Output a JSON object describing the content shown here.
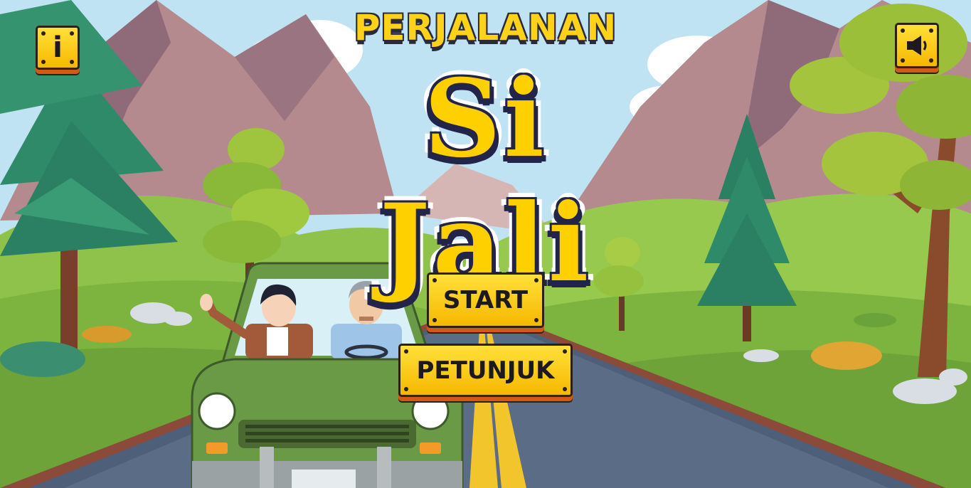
{
  "title": {
    "line1": "PERJALANAN",
    "line2": "Si Jali"
  },
  "buttons": {
    "start_label": "START",
    "petunjuk_label": "PETUNJUK",
    "info_label": "i",
    "sound_icon": "speaker-icon"
  },
  "colors": {
    "button_yellow": "#ffd21a",
    "title_yellow": "#ffd000",
    "outline_dark": "#23244a",
    "car_green": "#6a9a46",
    "road": "#4d5f79"
  }
}
